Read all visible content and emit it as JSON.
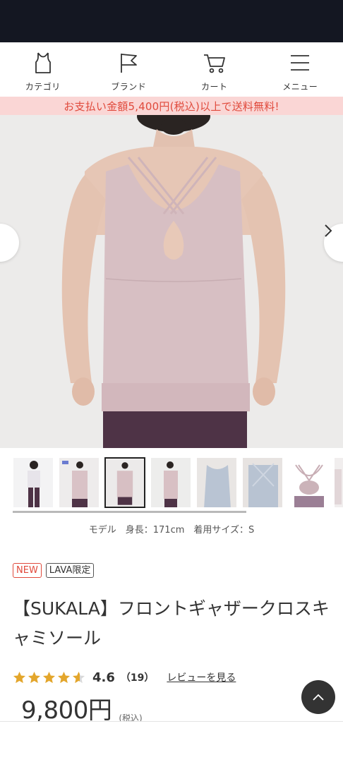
{
  "nav": {
    "items": [
      {
        "label": "カテゴリ",
        "icon": "tank-top-icon"
      },
      {
        "label": "ブランド",
        "icon": "flag-icon"
      },
      {
        "label": "カート",
        "icon": "cart-icon"
      },
      {
        "label": "メニュー",
        "icon": "menu-icon"
      }
    ]
  },
  "banner": {
    "text": "お支払い金額5,400円(税込)以上で送料無料!",
    "color": "#e04a3c",
    "background": "#fad6d5"
  },
  "gallery": {
    "prev_icon": "chevron-left-icon",
    "next_icon": "chevron-right-icon",
    "thumbnail_count": 8,
    "active_thumbnail": 3
  },
  "model_caption": "モデル　身長：171cm　着用サイズ：S",
  "badges": {
    "new": "NEW",
    "limited": "LAVA限定"
  },
  "product": {
    "title": "【SUKALA】フロントギャザークロスキャミソール"
  },
  "rating": {
    "value": "4.6",
    "count": "（19）",
    "review_link": "レビューを見る",
    "stars": 4.6,
    "star_color": "#e3a62c"
  },
  "price": {
    "amount": "9,800円",
    "tax": "(税込)"
  },
  "scroll_top_icon": "chevron-up-icon"
}
